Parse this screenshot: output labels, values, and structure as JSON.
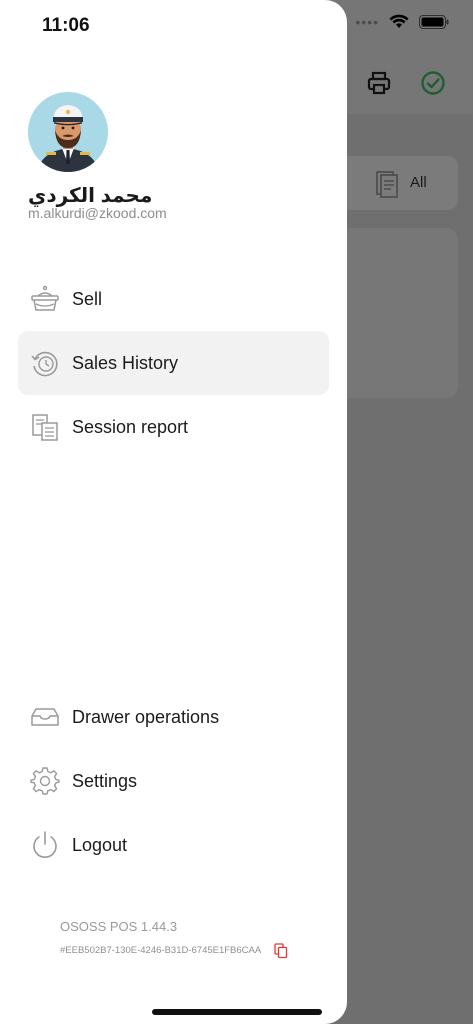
{
  "status_bar": {
    "time": "11:06"
  },
  "background": {
    "filter_label": "All"
  },
  "user": {
    "name": "محمد الكردي",
    "email": "m.alkurdi@zkood.com"
  },
  "menu": {
    "items": [
      {
        "label": "Sell",
        "icon": "basket-icon",
        "active": false
      },
      {
        "label": "Sales History",
        "icon": "history-clock-icon",
        "active": true
      },
      {
        "label": "Session report",
        "icon": "report-icon",
        "active": false
      }
    ],
    "bottom_items": [
      {
        "label": "Drawer operations",
        "icon": "drawer-icon"
      },
      {
        "label": "Settings",
        "icon": "gear-icon"
      },
      {
        "label": "Logout",
        "icon": "power-icon"
      }
    ]
  },
  "footer": {
    "version": "OSOSS POS 1.44.3",
    "device_id": "#EEB502B7-130E-4246-B31D-6745E1FB6CAA"
  },
  "colors": {
    "accent_red": "#e53935",
    "check_green": "#1f7a3a",
    "active_bg": "#f2f2f2"
  }
}
